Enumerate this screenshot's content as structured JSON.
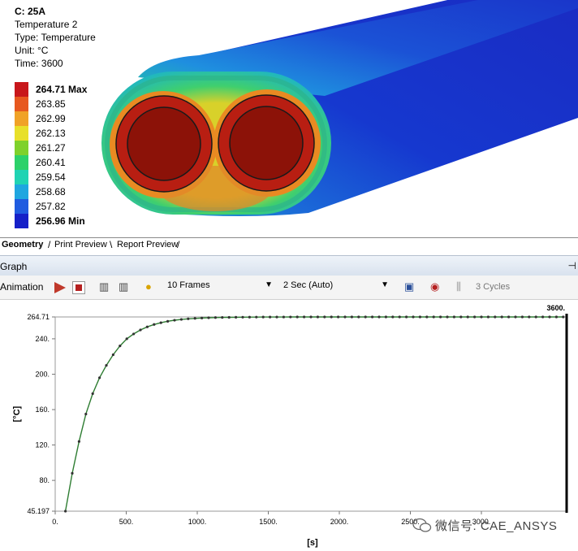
{
  "result": {
    "title": "C: 25A",
    "name": "Temperature 2",
    "type": "Type: Temperature",
    "unit": "Unit: °C",
    "time": "Time: 3600"
  },
  "legend": [
    {
      "label": "264.71 Max",
      "color": "#c8171b",
      "bold": true
    },
    {
      "label": "263.85",
      "color": "#e7581f",
      "bold": false
    },
    {
      "label": "262.99",
      "color": "#f0a227",
      "bold": false
    },
    {
      "label": "262.13",
      "color": "#e8e02a",
      "bold": false
    },
    {
      "label": "261.27",
      "color": "#7fd12b",
      "bold": false
    },
    {
      "label": "260.41",
      "color": "#2cd16a",
      "bold": false
    },
    {
      "label": "259.54",
      "color": "#20d3b3",
      "bold": false
    },
    {
      "label": "258.68",
      "color": "#1fa6e0",
      "bold": false
    },
    {
      "label": "257.82",
      "color": "#1f5ce0",
      "bold": false
    },
    {
      "label": "256.96 Min",
      "color": "#1520c8",
      "bold": true
    }
  ],
  "tabs": {
    "geometry": "Geometry",
    "print_preview": "Print Preview",
    "report_preview": "Report Preview"
  },
  "graph": {
    "title": "Graph",
    "animation_label": "Animation",
    "frames": "10 Frames",
    "speed": "2 Sec (Auto)",
    "cycles": "3 Cycles"
  },
  "icons": [
    "play-icon",
    "stop-icon",
    "distributed-frames-icon",
    "result-sets-icon",
    "lightbulb-icon",
    "export-video-icon",
    "zoom-to-fit-icon",
    "cycles-icon",
    "pin-icon"
  ],
  "watermark": "微信号: CAE_ANSYS",
  "chart_data": {
    "type": "line",
    "xlabel": "[s]",
    "ylabel": "[°C]",
    "xlim": [
      0,
      3600
    ],
    "ylim": [
      45.197,
      264.71
    ],
    "x_ticks": [
      "0.",
      "500.",
      "1000.",
      "1500.",
      "2000.",
      "2500.",
      "3000."
    ],
    "x_tick_values": [
      0,
      500,
      1000,
      1500,
      2000,
      2500,
      3000
    ],
    "y_ticks": [
      "45.197",
      "80.",
      "120.",
      "160.",
      "200.",
      "240.",
      "264.71"
    ],
    "y_tick_values": [
      45.197,
      80,
      120,
      160,
      200,
      240,
      264.71
    ],
    "cursor_label": "3600.",
    "cursor_x": 3600,
    "line_color": "#2e7d32",
    "series": [
      {
        "x": [
          72,
          120,
          168,
          216,
          264,
          312,
          360,
          408,
          456,
          504,
          552,
          600,
          648,
          696,
          744,
          792,
          840,
          888,
          936,
          984,
          1032,
          1080,
          1128,
          1176,
          1224,
          1272,
          1320,
          1368,
          1416,
          1464,
          1512,
          1560,
          1608,
          1656,
          1704,
          1752,
          1800,
          1848,
          1896,
          1944,
          1992,
          2040,
          2088,
          2136,
          2184,
          2232,
          2280,
          2328,
          2376,
          2424,
          2472,
          2520,
          2568,
          2616,
          2664,
          2712,
          2760,
          2808,
          2856,
          2904,
          2952,
          3000,
          3048,
          3096,
          3144,
          3192,
          3240,
          3288,
          3336,
          3384,
          3432,
          3480,
          3528,
          3576
        ],
        "y": [
          45.197,
          88,
          124,
          155,
          178,
          196,
          210,
          222,
          232,
          240,
          245.5,
          250,
          253.5,
          256.2,
          258.2,
          259.8,
          261,
          261.9,
          262.6,
          263.1,
          263.5,
          263.8,
          264.0,
          264.15,
          264.27,
          264.36,
          264.43,
          264.49,
          264.54,
          264.58,
          264.61,
          264.63,
          264.65,
          264.67,
          264.68,
          264.69,
          264.7,
          264.7,
          264.71,
          264.71,
          264.71,
          264.71,
          264.71,
          264.71,
          264.71,
          264.71,
          264.71,
          264.71,
          264.71,
          264.71,
          264.71,
          264.71,
          264.71,
          264.71,
          264.71,
          264.71,
          264.71,
          264.71,
          264.71,
          264.71,
          264.71,
          264.71,
          264.71,
          264.71,
          264.71,
          264.71,
          264.71,
          264.71,
          264.71,
          264.71,
          264.71,
          264.71,
          264.71,
          264.71
        ]
      }
    ]
  }
}
